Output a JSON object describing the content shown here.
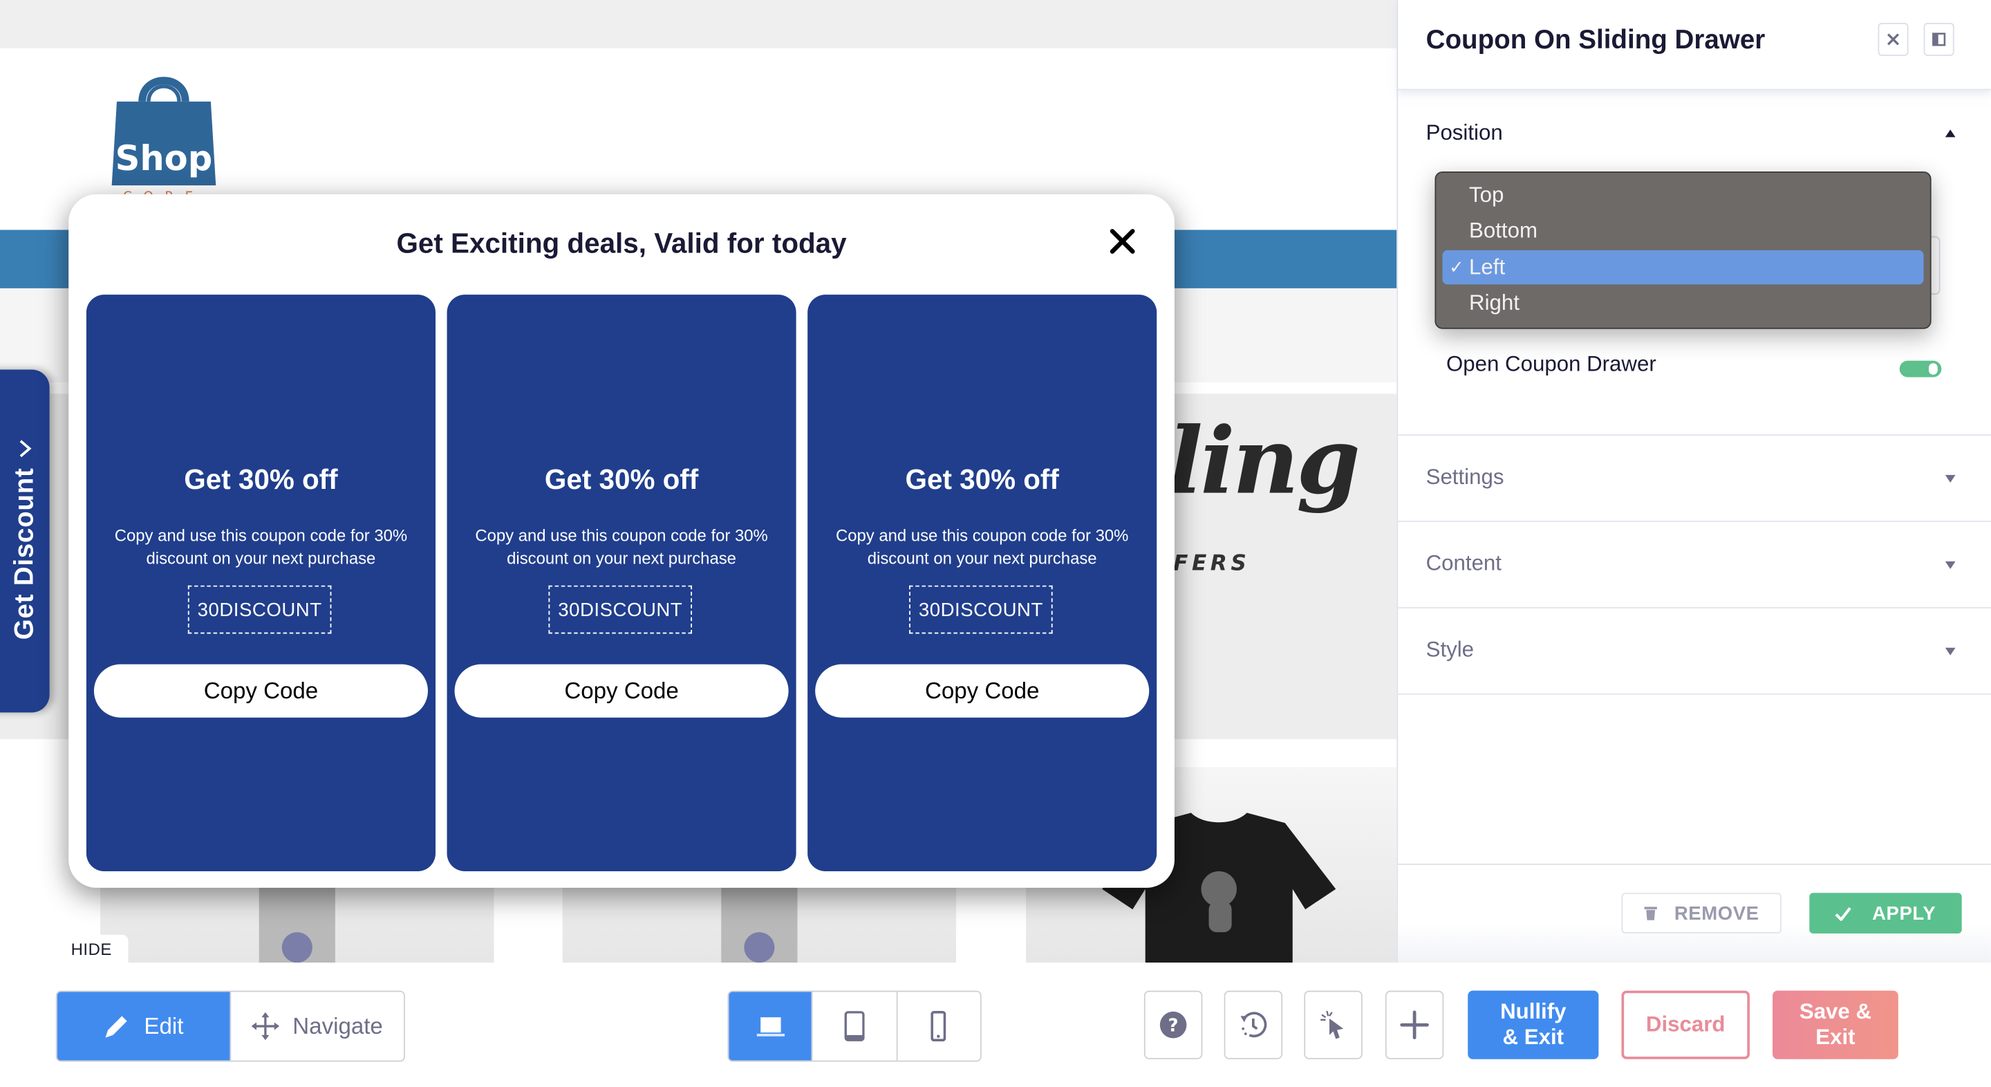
{
  "canvas": {
    "logo": {
      "text": "Shop",
      "subtext": "CORE"
    },
    "banner": {
      "script_text": "ling",
      "sub_text": "FERS"
    },
    "hide_label": "HIDE",
    "side_tab": {
      "label": "Get Discount",
      "icon": "chevron-right-icon"
    }
  },
  "modal": {
    "title": "Get Exciting deals, Valid for today",
    "close_icon": "close-icon",
    "cards": [
      {
        "title": "Get 30% off",
        "description": "Copy and use this coupon code for 30% discount on your next purchase",
        "code": "30DISCOUNT",
        "button": "Copy Code"
      },
      {
        "title": "Get 30% off",
        "description": "Copy and use this coupon code for 30% discount on your next purchase",
        "code": "30DISCOUNT",
        "button": "Copy Code"
      },
      {
        "title": "Get 30% off",
        "description": "Copy and use this coupon code for 30% discount on your next purchase",
        "code": "30DISCOUNT",
        "button": "Copy Code"
      }
    ]
  },
  "panel": {
    "title": "Coupon On Sliding Drawer",
    "sections": {
      "position": {
        "label": "Position",
        "expanded": true
      },
      "settings": {
        "label": "Settings",
        "expanded": false
      },
      "content": {
        "label": "Content",
        "expanded": false
      },
      "style": {
        "label": "Style",
        "expanded": false
      }
    },
    "position_select": {
      "options": [
        "Top",
        "Bottom",
        "Left",
        "Right"
      ],
      "selected": "Left",
      "check_mark": "✓"
    },
    "open_drawer_toggle": {
      "label": "Open Coupon Drawer",
      "on": true
    },
    "footer": {
      "remove_label": "REMOVE",
      "apply_label": "APPLY"
    }
  },
  "toolbar": {
    "mode": {
      "edit_label": "Edit",
      "navigate_label": "Navigate",
      "active": "Edit"
    },
    "devices": {
      "active": "desktop",
      "items": [
        "desktop",
        "tablet",
        "mobile"
      ]
    },
    "icons": [
      "help-icon",
      "history-icon",
      "select-element-icon",
      "add-icon"
    ],
    "nullify_label": "Nullify\n& Exit",
    "discard_label": "Discard",
    "save_label": "Save &\nExit"
  },
  "colors": {
    "coupon_blue": "#203e8c",
    "nav_blue": "#3a7fb4",
    "accent_blue": "#418bef",
    "apply_green": "#5ac18e",
    "discard_pink": "#e88c9a",
    "dropdown_bg": "#6e6a67",
    "dropdown_selected": "#6a98e0"
  }
}
